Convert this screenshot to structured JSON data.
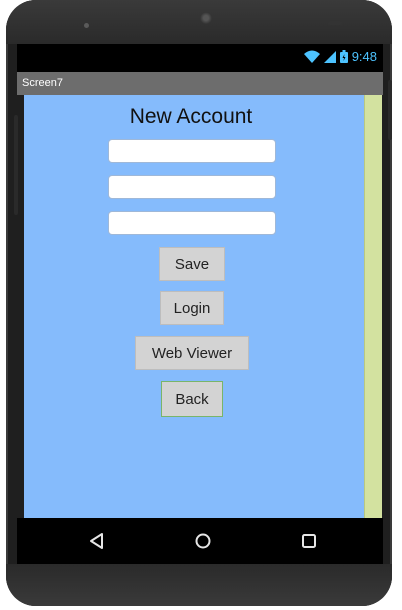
{
  "status_bar": {
    "time": "9:48",
    "icons": [
      "wifi-icon",
      "signal-icon",
      "battery-icon"
    ],
    "accent_color": "#4dc3ff"
  },
  "title_bar": {
    "title": "Screen7"
  },
  "screen": {
    "background_color": "#85bbfc",
    "heading": "New Account",
    "inputs": [
      {
        "value": "",
        "placeholder": ""
      },
      {
        "value": "",
        "placeholder": ""
      },
      {
        "value": "",
        "placeholder": ""
      }
    ],
    "buttons": {
      "save": "Save",
      "login": "Login",
      "web_viewer": "Web Viewer",
      "back": "Back"
    }
  },
  "nav_bar": {
    "icons": [
      "back-triangle-icon",
      "home-circle-icon",
      "recents-square-icon"
    ]
  }
}
